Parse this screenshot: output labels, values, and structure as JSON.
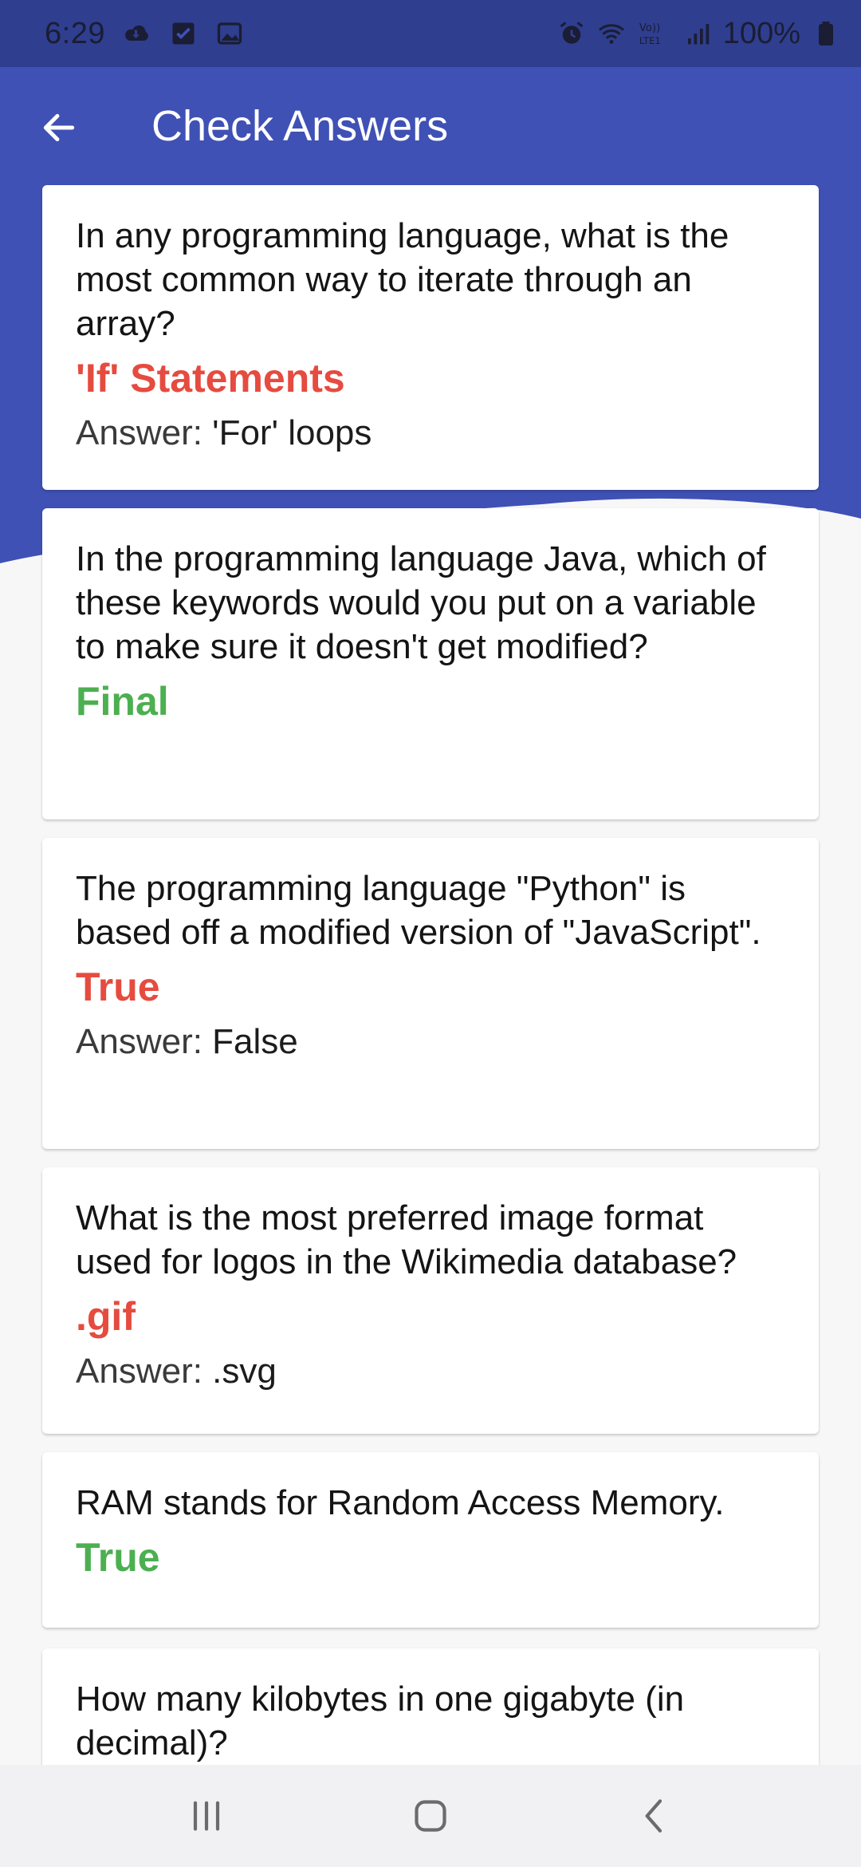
{
  "status_bar": {
    "time": "6:29",
    "battery_text": "100%",
    "icons_left": [
      "cloud-icon",
      "checkbox-icon",
      "image-icon"
    ],
    "icons_right": [
      "alarm-icon",
      "wifi-icon",
      "volte-icon",
      "signal-icon",
      "battery-icon"
    ],
    "volte_label": "Vo)) LTE1"
  },
  "app_bar": {
    "title": "Check Answers",
    "back_icon": "arrow-back-icon"
  },
  "colors": {
    "header_blue": "#3f51b5",
    "status_blue": "#2f3e8f",
    "wrong_red": "#e64b3f",
    "correct_green": "#4caf50",
    "background": "#f7f7f8"
  },
  "cards": [
    {
      "question": "In any programming language, what is the most common way to iterate through an array?",
      "selected": "'If' Statements",
      "status": "wrong",
      "answer_label": "Answer: ",
      "answer_value": "'For' loops"
    },
    {
      "question": "In the programming language Java, which of these keywords would you put on a variable to make sure it doesn't get modified?",
      "selected": "Final",
      "status": "correct"
    },
    {
      "question": "The programming language \"Python\" is based off a modified version of \"JavaScript\".",
      "selected": "True",
      "status": "wrong",
      "answer_label": "Answer: ",
      "answer_value": "False"
    },
    {
      "question": "What is the most preferred image format used for logos in the Wikimedia database?",
      "selected": ".gif",
      "status": "wrong",
      "answer_label": "Answer: ",
      "answer_value": ".svg"
    },
    {
      "question": "RAM stands for Random Access Memory.",
      "selected": "True",
      "status": "correct"
    },
    {
      "question": "How many kilobytes in one gigabyte (in decimal)?"
    }
  ],
  "nav_bar": {
    "icons": [
      "recent-apps-icon",
      "home-icon",
      "back-nav-icon"
    ]
  }
}
